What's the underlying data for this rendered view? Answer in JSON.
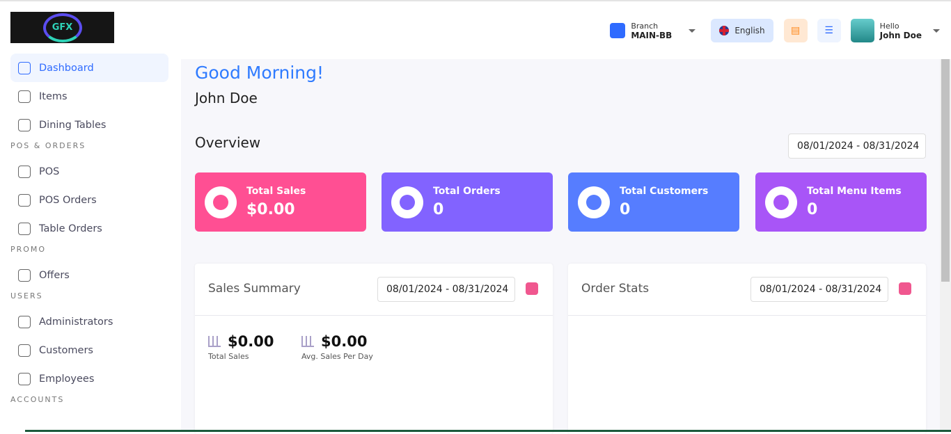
{
  "header": {
    "logo_text": "GFX",
    "branch_label": "Branch",
    "branch_value": "MAIN-BB",
    "language": "English",
    "greeting_small": "Hello",
    "user_name": "John Doe"
  },
  "sidebar": {
    "items": [
      {
        "label": "Dashboard",
        "active": true,
        "icon": "dashboard-icon"
      },
      {
        "label": "Items",
        "icon": "box-icon"
      },
      {
        "label": "Dining Tables",
        "icon": "table-icon"
      },
      {
        "section": "POS & ORDERS"
      },
      {
        "label": "POS",
        "icon": "receipt-icon"
      },
      {
        "label": "POS Orders",
        "icon": "orders-icon"
      },
      {
        "label": "Table Orders",
        "icon": "cloche-icon"
      },
      {
        "section": "PROMO"
      },
      {
        "label": "Offers",
        "icon": "discount-icon"
      },
      {
        "section": "USERS"
      },
      {
        "label": "Administrators",
        "icon": "user-icon"
      },
      {
        "label": "Customers",
        "icon": "customers-icon"
      },
      {
        "label": "Employees",
        "icon": "employees-icon"
      },
      {
        "section": "ACCOUNTS"
      }
    ]
  },
  "main": {
    "greeting": "Good Morning!",
    "user_name": "John Doe",
    "overview_title": "Overview",
    "date_range": "08/01/2024  -  08/31/2024",
    "cards": [
      {
        "label": "Total Sales",
        "value": "$0.00",
        "color": "#ff4f93"
      },
      {
        "label": "Total Orders",
        "value": "0",
        "color": "#8263ff"
      },
      {
        "label": "Total Customers",
        "value": "0",
        "color": "#567dff"
      },
      {
        "label": "Total Menu Items",
        "value": "0",
        "color": "#a855f7"
      }
    ],
    "sales_summary": {
      "title": "Sales Summary",
      "date_range": "08/01/2024  -  08/31/2024",
      "total_sales_value": "$0.00",
      "total_sales_label": "Total Sales",
      "avg_value": "$0.00",
      "avg_label": "Avg. Sales Per Day"
    },
    "order_stats": {
      "title": "Order Stats",
      "date_range": "08/01/2024  -  08/31/2024"
    }
  }
}
